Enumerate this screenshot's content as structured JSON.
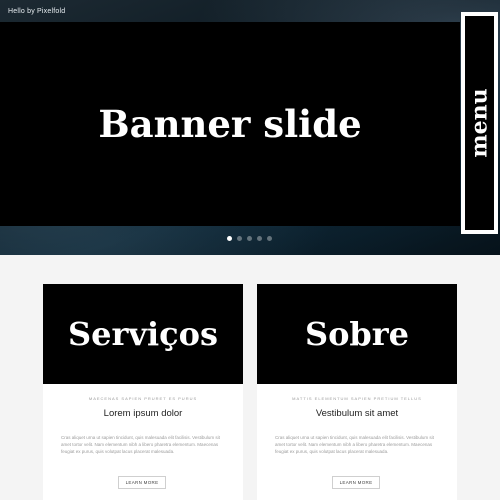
{
  "header": {
    "brand": "Hello by Pixelfold"
  },
  "banner": {
    "title": "Banner slide"
  },
  "menu": {
    "label": "menu"
  },
  "slider": {
    "dot_count": 5,
    "active_index": 0
  },
  "cards": [
    {
      "heading": "Serviços",
      "eyebrow": "MAECENAS SAPIEN PRURET ES PURUS",
      "title": "Lorem ipsum dolor",
      "text": "Cras aliquet urna ut sapien tincidunt, quis malesuada elit facilisis. Vestibulum sit amet tortor velit. Nam elementum nibh a libero pharetra elementum. Maecenas feugiat ex purus, quis volutpat lacus placerat malesuada.",
      "button": "LEARN MORE"
    },
    {
      "heading": "Sobre",
      "eyebrow": "MATTIS ELEMENTUM SAPIEN PRETIUM TELLUS",
      "title": "Vestibulum sit amet",
      "text": "Cras aliquet urna ut sapien tincidunt, quis malesuada elit facilisis. Vestibulum sit amet tortor velit. Nam elementum nibh a libero pharetra elementum. Maecenas feugiat ex purus, quis volutpat lacus placerat malesuada.",
      "button": "LEARN MORE"
    }
  ]
}
